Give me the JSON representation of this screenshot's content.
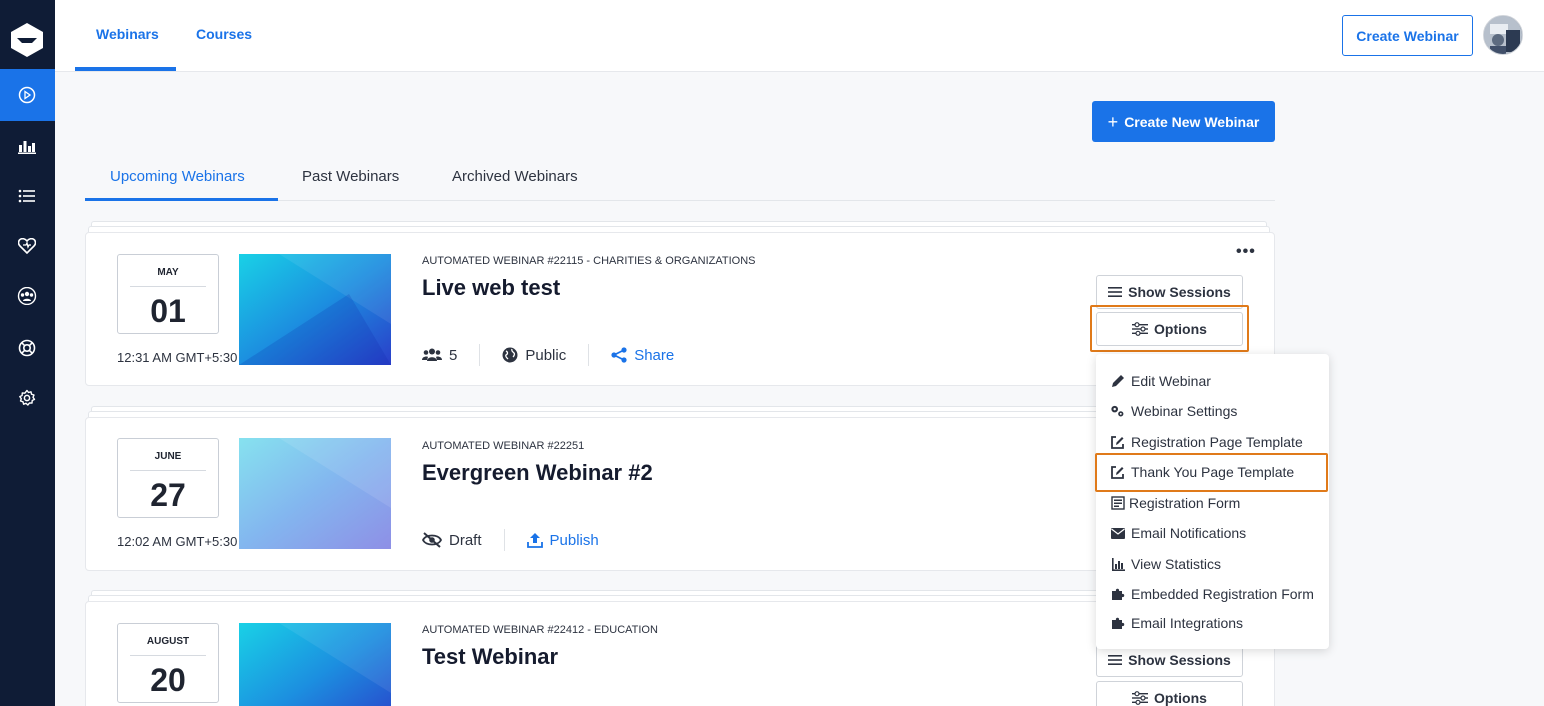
{
  "top_nav": {
    "tabs": [
      "Webinars",
      "Courses"
    ],
    "active_tab": "Webinars",
    "create_webinar_label": "Create Webinar"
  },
  "sidebar": {
    "icons": [
      "logo-icon",
      "play-icon",
      "analytics-icon",
      "list-icon",
      "heart-icon",
      "users-icon",
      "help-icon",
      "settings-icon"
    ],
    "active": "play-icon"
  },
  "main": {
    "create_new_label": "Create New Webinar",
    "subtabs": [
      "Upcoming Webinars",
      "Past Webinars",
      "Archived Webinars"
    ],
    "active_subtab": "Upcoming Webinars"
  },
  "webinars": [
    {
      "month": "MAY",
      "day": "01",
      "time": "12:31 AM GMT+5:30",
      "subtitle": "AUTOMATED WEBINAR #22115 - CHARITIES & ORGANIZATIONS",
      "title": "Live web test",
      "attendees": "5",
      "visibility": "Public",
      "share_label": "Share",
      "show_sessions_label": "Show Sessions",
      "options_label": "Options"
    },
    {
      "month": "JUNE",
      "day": "27",
      "time": "12:02 AM GMT+5:30",
      "subtitle": "AUTOMATED WEBINAR #22251",
      "title": "Evergreen Webinar #2",
      "status": "Draft",
      "publish_label": "Publish"
    },
    {
      "month": "AUGUST",
      "day": "20",
      "subtitle": "AUTOMATED WEBINAR #22412 - EDUCATION",
      "title": "Test Webinar",
      "show_sessions_label": "Show Sessions",
      "options_label": "Options"
    }
  ],
  "options_menu": {
    "items": [
      {
        "label": "Edit Webinar",
        "icon": "pencil-icon"
      },
      {
        "label": "Webinar Settings",
        "icon": "gears-icon"
      },
      {
        "label": "Registration Page Template",
        "icon": "edit-square-icon"
      },
      {
        "label": "Thank You Page Template",
        "icon": "edit-square-icon"
      },
      {
        "label": "Registration Form",
        "icon": "form-icon"
      },
      {
        "label": "Email Notifications",
        "icon": "envelope-icon"
      },
      {
        "label": "View Statistics",
        "icon": "bar-chart-icon"
      },
      {
        "label": "Embedded Registration Form",
        "icon": "puzzle-icon"
      },
      {
        "label": "Email Integrations",
        "icon": "puzzle-icon"
      }
    ],
    "highlighted": "Thank You Page Template"
  },
  "colors": {
    "accent": "#1a73e8",
    "sidebar": "#0f1c36",
    "highlight": "#e07a1a"
  }
}
